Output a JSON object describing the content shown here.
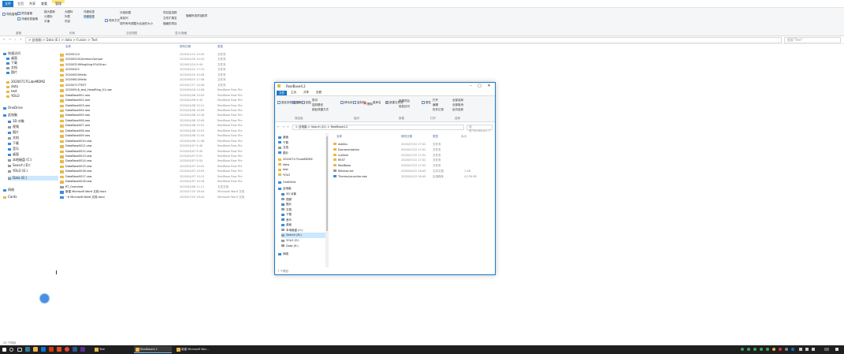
{
  "ribbon_tabs": [
    {
      "label": "文件",
      "active": true
    },
    {
      "label": "主页",
      "active": false
    },
    {
      "label": "共享",
      "active": false
    },
    {
      "label": "查看",
      "active": false
    },
    {
      "label": "管理",
      "active": false
    }
  ],
  "ribbon": {
    "nav_pane": "导航窗格",
    "preview_pane": "预览窗格",
    "details_pane": "详细信息窗格",
    "extra_large_icons": "超大图标",
    "large_icons": "大图标",
    "small_icons": "小图标",
    "list": "列表",
    "details": "详细信息",
    "tiles": "平铺",
    "content": "内容",
    "sort_by": "排序方式",
    "group_by": "分组依据",
    "add_columns": "添加列",
    "size_all_columns": "将所有列调整为合适的大小",
    "item_checkboxes": "项目复选框",
    "file_name_extensions": "文件扩展名",
    "hidden_items": "隐藏的项目",
    "hide_selected": "隐藏所选项目",
    "options": "选项",
    "groups": [
      "窗格",
      "布局",
      "当前视图",
      "显示/隐藏"
    ]
  },
  "address": {
    "path": "> 此电脑 > Data (E:) > data > Fusion > Test",
    "search_placeholder": "搜索\"Test\""
  },
  "column_headers": {
    "name": "名称",
    "date": "修改日期",
    "type": "类型"
  },
  "sidebar": [
    {
      "label": "快速访问",
      "icon": "star"
    },
    {
      "label": "桌面",
      "icon": "folder-blue"
    },
    {
      "label": "下载",
      "icon": "download"
    },
    {
      "label": "文档",
      "icon": "doc"
    },
    {
      "label": "图片",
      "icon": "pic"
    },
    {
      "label": "20200717CubeMDM2",
      "icon": "folder"
    },
    {
      "label": "data",
      "icon": "folder"
    },
    {
      "label": "test",
      "icon": "folder"
    },
    {
      "label": "YOLO",
      "icon": "folder"
    },
    {
      "label": "OneDrive",
      "icon": "cloud"
    },
    {
      "label": "此电脑",
      "icon": "pc"
    },
    {
      "label": "3D 对象",
      "icon": "3d"
    },
    {
      "label": "视频",
      "icon": "video"
    },
    {
      "label": "图片",
      "icon": "pic"
    },
    {
      "label": "文档",
      "icon": "doc"
    },
    {
      "label": "下载",
      "icon": "download"
    },
    {
      "label": "音乐",
      "icon": "music"
    },
    {
      "label": "桌面",
      "icon": "folder-blue"
    },
    {
      "label": "本地磁盘 (C:)",
      "icon": "drive"
    },
    {
      "label": "Search (D:)",
      "icon": "drive"
    },
    {
      "label": "YOLO (E:)",
      "icon": "drive"
    },
    {
      "label": "Data (E:)",
      "icon": "drive",
      "selected": true
    },
    {
      "label": "网络",
      "icon": "network"
    },
    {
      "label": "Cards",
      "icon": "folder"
    }
  ],
  "files": [
    {
      "name": "20200114",
      "date": "2020/01/14 15:05",
      "type": "文件夹",
      "icon": "folder"
    },
    {
      "name": "20200220CommonCompar",
      "date": "2020/02/20 14:54",
      "type": "文件夹",
      "icon": "folder"
    },
    {
      "name": "20200324MingXing-YOLOfusn",
      "date": "2020/03/24 9:49",
      "type": "文件夹",
      "icon": "folder"
    },
    {
      "name": "20200422",
      "date": "2020/04/22 17:15",
      "type": "文件夹",
      "icon": "folder"
    },
    {
      "name": "20200520Hello",
      "date": "2020/05/20 10:08",
      "type": "文件夹",
      "icon": "folder"
    },
    {
      "name": "20200610Hello",
      "date": "2020/06/10 17:08",
      "type": "文件夹",
      "icon": "folder"
    },
    {
      "name": "20200717TEST",
      "date": "2020/07/17 14:08",
      "type": "文件夹",
      "icon": "folder"
    },
    {
      "name": "20200918_test_HeadRing_01.raw",
      "date": "2020/09/18 14:08",
      "type": "RealBase Raw File",
      "icon": "raw"
    },
    {
      "name": "DataBase001.raw",
      "date": "2020/04/08 10:00",
      "type": "RealBase Raw File",
      "icon": "raw"
    },
    {
      "name": "DataBase002.raw",
      "date": "2020/04/08 9:40",
      "type": "RealBase Raw File",
      "icon": "raw"
    },
    {
      "name": "DataBase003.raw",
      "date": "2020/04/08 10:11",
      "type": "RealBase Raw File",
      "icon": "raw"
    },
    {
      "name": "DataBase004.raw",
      "date": "2020/04/08 10:05",
      "type": "RealBase Raw File",
      "icon": "raw"
    },
    {
      "name": "DataBase005.raw",
      "date": "2020/04/08 10:18",
      "type": "RealBase Raw File",
      "icon": "raw"
    },
    {
      "name": "DataBase006.raw",
      "date": "2020/04/08 10:49",
      "type": "RealBase Raw File",
      "icon": "raw"
    },
    {
      "name": "DataBase007.raw",
      "date": "2020/04/08 10:51",
      "type": "RealBase Raw File",
      "icon": "raw"
    },
    {
      "name": "DataBase008.raw",
      "date": "2020/04/08 10:53",
      "type": "RealBase Raw File",
      "icon": "raw"
    },
    {
      "name": "DataBase009.raw",
      "date": "2020/04/08 11:04",
      "type": "RealBase Raw File",
      "icon": "raw"
    },
    {
      "name": "DataBase0010.raw",
      "date": "2020/04/08 11:06",
      "type": "RealBase Raw File",
      "icon": "raw"
    },
    {
      "name": "DataBase0011.raw",
      "date": "2020/04/07 9:40",
      "type": "RealBase Raw File",
      "icon": "raw"
    },
    {
      "name": "DataBase0012.raw",
      "date": "2020/04/07 9:45",
      "type": "RealBase Raw File",
      "icon": "raw"
    },
    {
      "name": "DataBase0013.raw",
      "date": "2020/04/07 9:51",
      "type": "RealBase Raw File",
      "icon": "raw"
    },
    {
      "name": "DataBase0014.raw",
      "date": "2020/04/07 9:55",
      "type": "RealBase Raw File",
      "icon": "raw"
    },
    {
      "name": "DataBase0015.raw",
      "date": "2020/04/07 10:01",
      "type": "RealBase Raw File",
      "icon": "raw"
    },
    {
      "name": "DataBase0016.raw",
      "date": "2020/04/07 10:05",
      "type": "RealBase Raw File",
      "icon": "raw"
    },
    {
      "name": "DataBase0017.raw",
      "date": "2020/04/07 10:12",
      "type": "RealBase Raw File",
      "icon": "raw"
    },
    {
      "name": "DataBase0018.raw",
      "date": "2020/04/07 10:18",
      "type": "RealBase Raw File",
      "icon": "raw"
    },
    {
      "name": "RT_Overview",
      "date": "2020/04/08 11:11",
      "type": "文本文档",
      "icon": "txt"
    },
    {
      "name": "新建 Microsoft Word 文档.docx",
      "date": "2020/07/20 18:44",
      "type": "Microsoft Word 文档",
      "icon": "word"
    },
    {
      "name": "~$ Microsoft Word 文档.docx",
      "date": "2020/07/20 18:44",
      "type": "Microsoft Word 文档",
      "icon": "word"
    }
  ],
  "status_text": "29 个项目",
  "window": {
    "title": "RealBase4.2",
    "tabs": [
      {
        "label": "文件",
        "active": true
      },
      {
        "label": "主页",
        "active": false
      },
      {
        "label": "共享",
        "active": false
      },
      {
        "label": "查看",
        "active": false
      }
    ],
    "ribbon": {
      "pin": "固定到快速访问",
      "copy": "复制",
      "paste": "粘贴",
      "cut": "剪切",
      "copy_path": "复制路径",
      "paste_shortcut": "粘贴快捷方式",
      "move_to": "移动到",
      "copy_to": "复制到",
      "delete": "删除",
      "rename": "重命名",
      "new_folder": "新建文件夹",
      "new_item": "新建项目",
      "easy_access": "轻松访问",
      "properties": "属性",
      "open": "打开",
      "edit": "编辑",
      "history": "历史记录",
      "select_all": "全部选择",
      "select_none": "全部取消",
      "invert": "反向选择",
      "groups": [
        "剪贴板",
        "组织",
        "新建",
        "打开",
        "选择"
      ]
    },
    "address": "> 此电脑 > Search (D:) > RealBase4.2",
    "search_placeholder": "搜索\"RealBase4.2\"",
    "headers": {
      "name": "名称",
      "date": "修改日期",
      "type": "类型",
      "size": "大小"
    },
    "sidebar": [
      {
        "label": "桌面",
        "icon": "folder-blue"
      },
      {
        "label": "下载",
        "icon": "download"
      },
      {
        "label": "文档",
        "icon": "doc"
      },
      {
        "label": "图片",
        "icon": "pic"
      },
      {
        "label": "20200717CubeMDM2",
        "icon": "folder"
      },
      {
        "label": "data",
        "icon": "folder"
      },
      {
        "label": "test",
        "icon": "folder"
      },
      {
        "label": "YOLO",
        "icon": "folder"
      },
      {
        "label": "OneDrive",
        "icon": "cloud"
      },
      {
        "label": "此电脑",
        "icon": "pc"
      },
      {
        "label": "3D 对象",
        "icon": "3d"
      },
      {
        "label": "视频",
        "icon": "video"
      },
      {
        "label": "图片",
        "icon": "pic"
      },
      {
        "label": "文档",
        "icon": "doc"
      },
      {
        "label": "下载",
        "icon": "download"
      },
      {
        "label": "音乐",
        "icon": "music"
      },
      {
        "label": "桌面",
        "icon": "folder-blue"
      },
      {
        "label": "本地磁盘 (C:)",
        "icon": "drive"
      },
      {
        "label": "Search (D:)",
        "icon": "drive",
        "selected": true
      },
      {
        "label": "YOLO (E:)",
        "icon": "drive"
      },
      {
        "label": "Data (E:)",
        "icon": "drive"
      },
      {
        "label": "网络",
        "icon": "network"
      }
    ],
    "files": [
      {
        "name": "Addins",
        "date": "2020/07/22 17:02",
        "type": "文件夹",
        "size": "",
        "icon": "folder"
      },
      {
        "name": "Documentation",
        "date": "2020/07/22 17:02",
        "type": "文件夹",
        "size": "",
        "icon": "folder"
      },
      {
        "name": "nuDesk",
        "date": "2020/07/22 17:02",
        "type": "文件夹",
        "size": "",
        "icon": "folder"
      },
      {
        "name": "REST",
        "date": "2020/07/22 17:02",
        "type": "文件夹",
        "size": "",
        "icon": "folder"
      },
      {
        "name": "RealBase",
        "date": "2020/07/22 17:02",
        "type": "文件夹",
        "size": "",
        "icon": "folder"
      },
      {
        "name": "Release.txt",
        "date": "2020/04/22 16:45",
        "type": "文本文档",
        "size": "1 KB",
        "icon": "txt"
      },
      {
        "name": "ThermoLauncher.exe",
        "date": "2020/04/22 16:45",
        "type": "应用程序",
        "size": "4,576 KB",
        "icon": "exe"
      }
    ],
    "status": "7 个项目"
  },
  "taskbar": {
    "apps": [
      {
        "label": "Test",
        "active": false
      },
      {
        "label": "RealBase4.2",
        "active": true
      },
      {
        "label": "新建 Microsoft Wor...",
        "active": false
      }
    ]
  }
}
